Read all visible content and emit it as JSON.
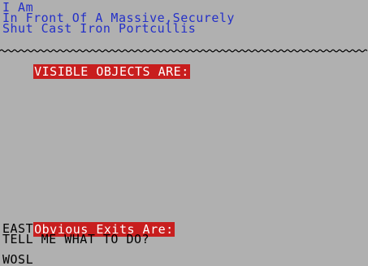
{
  "location": {
    "lines": [
      "I Am",
      "In Front Of A Massive,Securely",
      "Shut Cast Iron Portcullis"
    ]
  },
  "objects": {
    "header": "VISIBLE OBJECTS ARE:"
  },
  "exits": {
    "header": "Obvious Exits Are:",
    "list": "EAST"
  },
  "prompt": {
    "question": "TELL ME WHAT TO DO?",
    "input": "WOSL"
  },
  "colors": {
    "background": "#b0b0b0",
    "description_text": "#2430c8",
    "highlight_bg": "#c81e1e",
    "highlight_text": "#ffffff",
    "input_text": "#000000"
  }
}
